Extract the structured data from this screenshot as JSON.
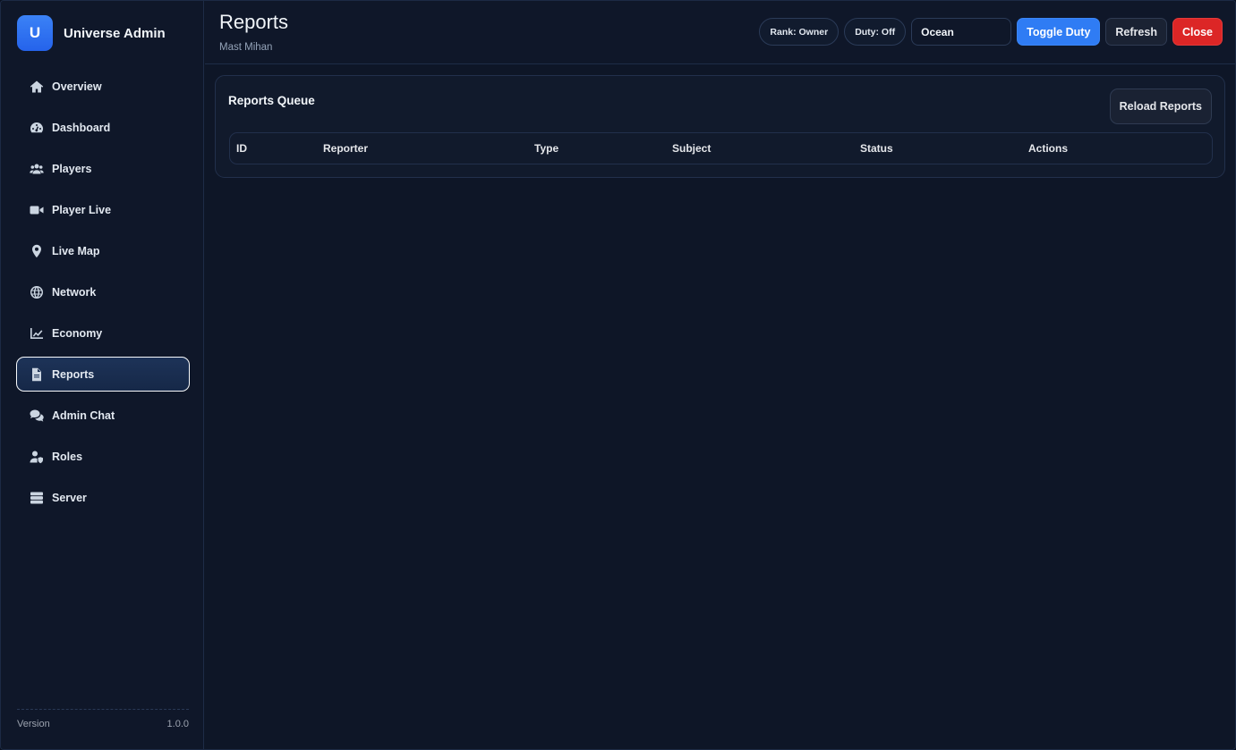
{
  "brand": {
    "logo_letter": "U",
    "title": "Universe Admin"
  },
  "sidebar": {
    "items": [
      {
        "label": "Overview",
        "icon": "home-icon"
      },
      {
        "label": "Dashboard",
        "icon": "gauge-icon"
      },
      {
        "label": "Players",
        "icon": "users-icon"
      },
      {
        "label": "Player Live",
        "icon": "video-icon"
      },
      {
        "label": "Live Map",
        "icon": "map-pin-icon"
      },
      {
        "label": "Network",
        "icon": "globe-icon"
      },
      {
        "label": "Economy",
        "icon": "chart-line-icon"
      },
      {
        "label": "Reports",
        "icon": "file-icon",
        "active": true
      },
      {
        "label": "Admin Chat",
        "icon": "comments-icon"
      },
      {
        "label": "Roles",
        "icon": "user-shield-icon"
      },
      {
        "label": "Server",
        "icon": "server-icon"
      }
    ],
    "footer": {
      "label": "Version",
      "value": "1.0.0"
    }
  },
  "header": {
    "title": "Reports",
    "subtitle": "Mast Mihan",
    "rank_pill": "Rank: Owner",
    "duty_pill": "Duty: Off",
    "theme_select": "Ocean",
    "toggle_duty_label": "Toggle Duty",
    "refresh_label": "Refresh",
    "close_label": "Close"
  },
  "reports": {
    "card_title": "Reports Queue",
    "reload_label": "Reload Reports",
    "columns": [
      "ID",
      "Reporter",
      "Type",
      "Subject",
      "Status",
      "Actions"
    ]
  },
  "colors": {
    "accent": "#2f7cf4",
    "danger": "#dc2626",
    "background": "#0e1627"
  }
}
